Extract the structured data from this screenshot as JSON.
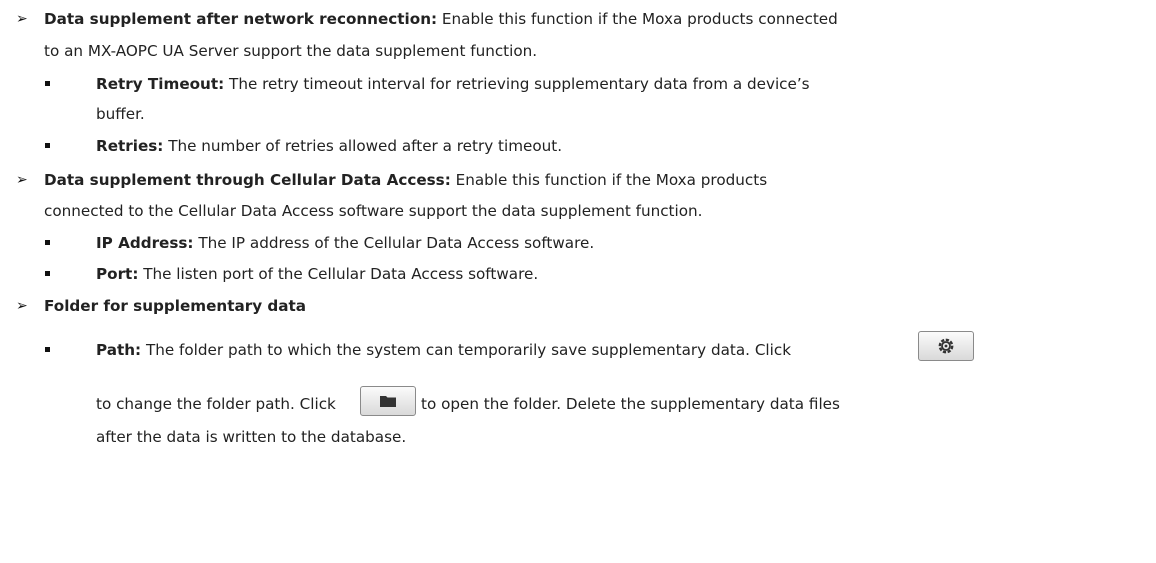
{
  "sections": [
    {
      "title": "Data supplement after network reconnection:",
      "line1": " Enable this function if the Moxa products connected",
      "line2": "to an MX-AOPC UA Server support the data supplement function.",
      "items": [
        {
          "title": "Retry Timeout:",
          "line1": " The retry timeout interval for retrieving supplementary data from a device’s",
          "line2": "buffer."
        },
        {
          "title": "Retries:",
          "line1": " The number of retries allowed after a retry timeout."
        }
      ]
    },
    {
      "title": "Data supplement through Cellular Data Access:",
      "line1": " Enable this function if the Moxa products",
      "line2": "connected to the Cellular Data Access software support the data supplement function.",
      "items": [
        {
          "title": "IP Address:",
          "line1": " The IP address of the Cellular Data Access software."
        },
        {
          "title": "Port:",
          "line1": " The listen port of the Cellular Data Access software."
        }
      ]
    },
    {
      "title": "Folder for supplementary data",
      "items": [
        {
          "title": "Path:",
          "line1": " The folder path to which the system can temporarily save supplementary data. Click",
          "line2a": "to change the folder path. Click",
          "line2b": "to open the folder. Delete the supplementary data files",
          "line3": "after the data is written to the database."
        }
      ]
    }
  ],
  "icons": {
    "change_path_button": "gear-icon",
    "open_folder_button": "folder-icon"
  }
}
